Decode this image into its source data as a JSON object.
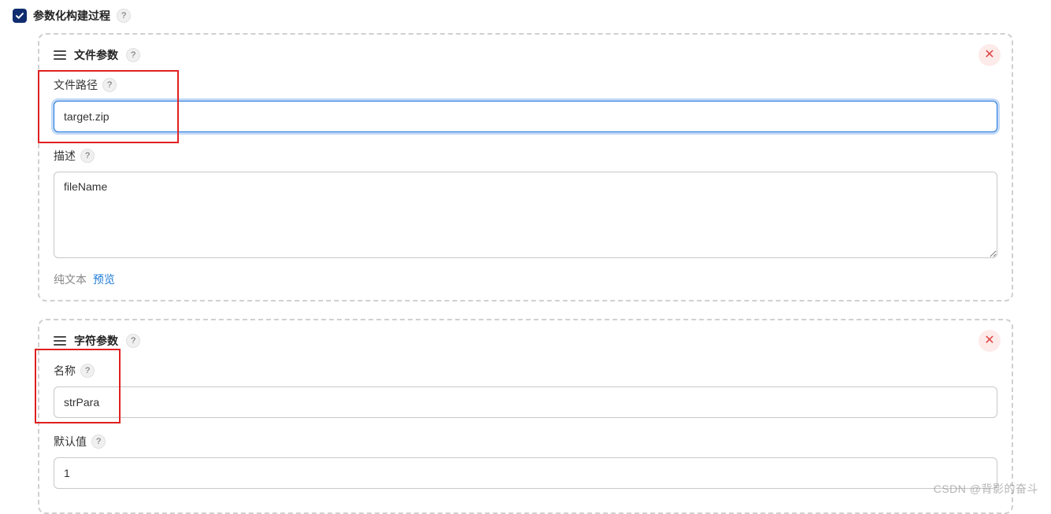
{
  "top": {
    "checkbox_label": "参数化构建过程",
    "help": "?"
  },
  "sections": [
    {
      "title": "文件参数",
      "help": "?",
      "fields": {
        "path_label": "文件路径",
        "path_value": "target.zip",
        "desc_label": "描述",
        "desc_value": "fileName"
      },
      "footer": {
        "plain_text": "纯文本",
        "preview_text": "预览"
      }
    },
    {
      "title": "字符参数",
      "help": "?",
      "fields": {
        "name_label": "名称",
        "name_value": "strPara",
        "default_label": "默认值",
        "default_value": "1"
      }
    }
  ],
  "watermark": "CSDN @背影的奋斗"
}
